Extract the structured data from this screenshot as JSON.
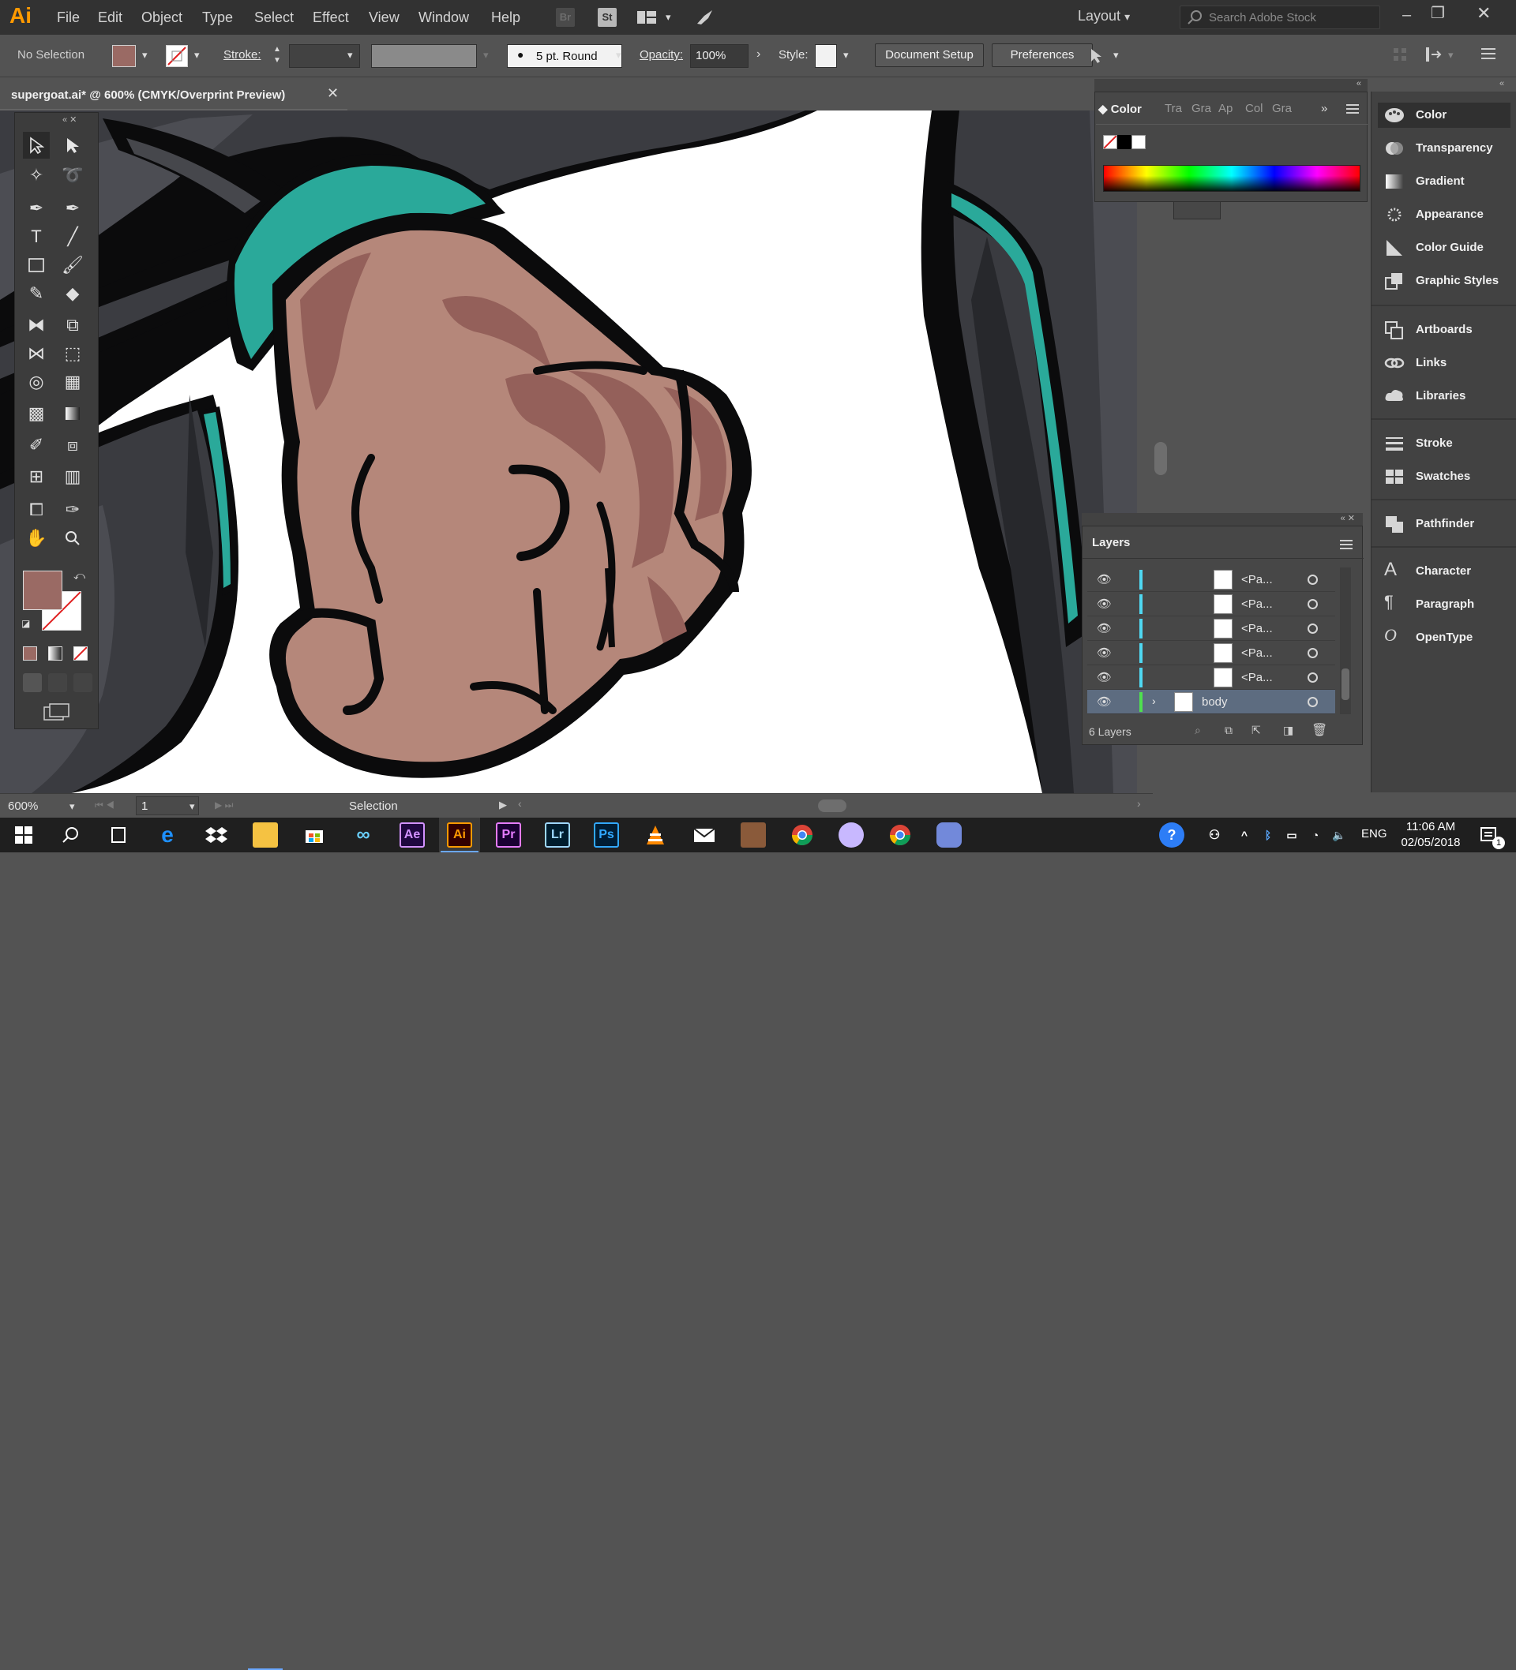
{
  "app": {
    "logo": "Ai",
    "search_placeholder": "Search Adobe Stock",
    "workspace": "Layout"
  },
  "menu": [
    "File",
    "Edit",
    "Object",
    "Type",
    "Select",
    "Effect",
    "View",
    "Window",
    "Help"
  ],
  "title_icons": {
    "bridge": "Br",
    "stock": "St"
  },
  "control": {
    "selection": "No Selection",
    "stroke_label": "Stroke:",
    "brush": "5 pt. Round",
    "opacity_label": "Opacity:",
    "opacity_value": "100%",
    "style_label": "Style:",
    "doc_setup": "Document Setup",
    "preferences": "Preferences",
    "fill_color": "#9a6a64"
  },
  "document": {
    "tab_title": "supergoat.ai* @ 600% (CMYK/Overprint Preview)"
  },
  "color_panel": {
    "tabs": [
      "Color",
      "Tra",
      "Gra",
      "Ap",
      "Col",
      "Gra"
    ]
  },
  "layers_panel": {
    "title": "Layers",
    "rows": [
      {
        "name": "<Pa..."
      },
      {
        "name": "<Pa..."
      },
      {
        "name": "<Pa..."
      },
      {
        "name": "<Pa..."
      },
      {
        "name": "<Pa..."
      },
      {
        "name": "body"
      }
    ],
    "footer": "6 Layers"
  },
  "dock": {
    "group1": [
      "Color",
      "Transparency",
      "Gradient",
      "Appearance",
      "Color Guide",
      "Graphic Styles"
    ],
    "group2": [
      "Artboards",
      "Links",
      "Libraries"
    ],
    "group3": [
      "Stroke",
      "Swatches"
    ],
    "group4": [
      "Pathfinder"
    ],
    "group5": [
      "Character",
      "Paragraph",
      "OpenType"
    ]
  },
  "status": {
    "zoom": "600%",
    "artboard": "1",
    "tool": "Selection"
  },
  "taskbar": {
    "apps": [
      "Ae",
      "Ai",
      "Pr",
      "Lr",
      "Ps"
    ],
    "language": "ENG",
    "time": "11:06 AM",
    "date": "02/05/2018",
    "notifications": "1"
  },
  "colors": {
    "teal": "#2aa99a",
    "skin_light": "#b5877a",
    "skin_dark": "#94605a",
    "outline": "#0b0b0c",
    "suit_dark": "#393a3e",
    "suit_mid": "#4a4b50"
  }
}
